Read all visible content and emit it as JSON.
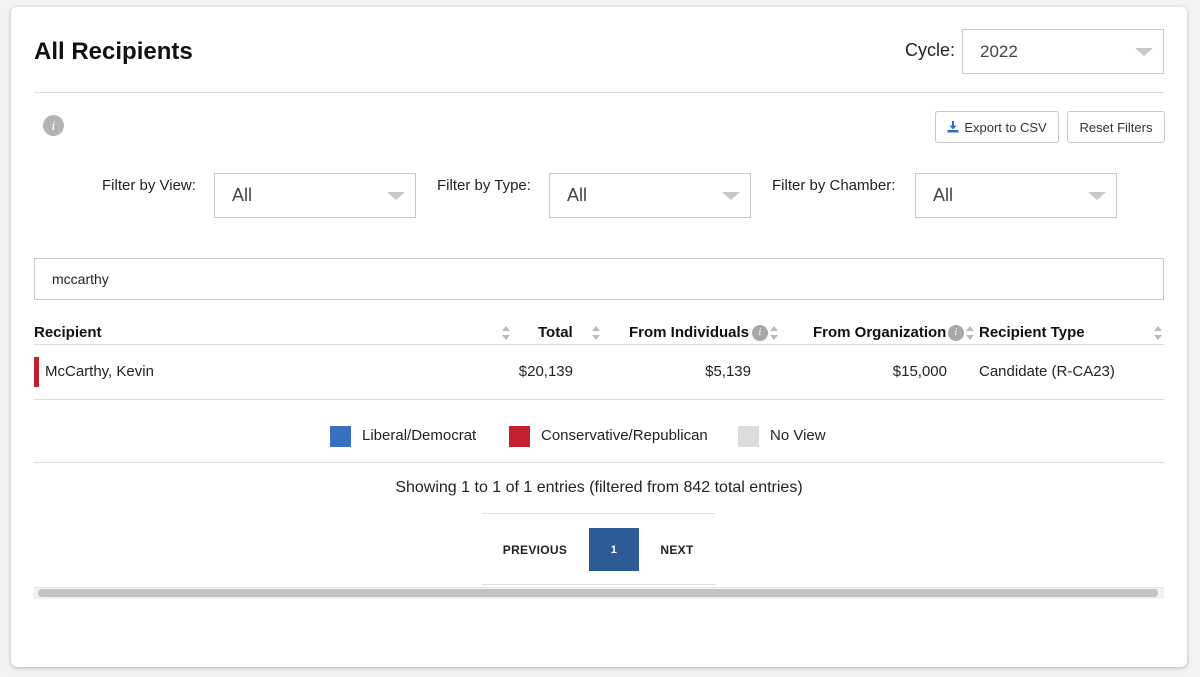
{
  "header": {
    "title": "All Recipients",
    "cycle_label": "Cycle:",
    "cycle_value": "2022"
  },
  "toolbar": {
    "info_glyph": "i",
    "export_label": "Export to CSV",
    "reset_label": "Reset Filters"
  },
  "filters": {
    "view": {
      "label": "Filter by View:",
      "value": "All"
    },
    "type": {
      "label": "Filter by Type:",
      "value": "All"
    },
    "chamber": {
      "label": "Filter by Chamber:",
      "value": "All"
    }
  },
  "search": {
    "value": "mccarthy"
  },
  "table": {
    "columns": [
      "Recipient",
      "Total",
      "From Individuals",
      "From Organization",
      "Recipient Type"
    ],
    "rows": [
      {
        "recipient": "McCarthy, Kevin",
        "total": "$20,139",
        "from_individuals": "$5,139",
        "from_organization": "$15,000",
        "recipient_type": "Candidate (R-CA23)",
        "party_color": "#c2202e"
      }
    ]
  },
  "legend": [
    {
      "label": "Liberal/Democrat",
      "color": "#3a70c0"
    },
    {
      "label": "Conservative/Republican",
      "color": "#c2202e"
    },
    {
      "label": "No View",
      "color": "#dcdcdc"
    }
  ],
  "pagination": {
    "info": "Showing 1 to 1 of 1 entries (filtered from 842 total entries)",
    "previous": "PREVIOUS",
    "current": "1",
    "next": "NEXT"
  }
}
